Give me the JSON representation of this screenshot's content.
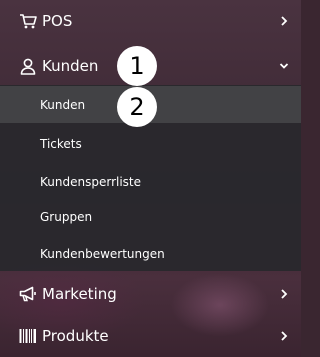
{
  "menu": {
    "pos": {
      "label": "POS",
      "icon": "cart-icon"
    },
    "kunden": {
      "label": "Kunden",
      "icon": "user-icon",
      "expanded": true
    },
    "kunden_sub": [
      {
        "label": "Kunden",
        "active": true
      },
      {
        "label": "Tickets"
      },
      {
        "label": "Kundensperrliste"
      },
      {
        "label": "Gruppen"
      },
      {
        "label": "Kundenbewertungen"
      }
    ],
    "marketing": {
      "label": "Marketing",
      "icon": "megaphone-icon"
    },
    "produkte": {
      "label": "Produkte",
      "icon": "barcode-icon"
    }
  },
  "annotations": {
    "badge1": "1",
    "badge2": "2"
  }
}
